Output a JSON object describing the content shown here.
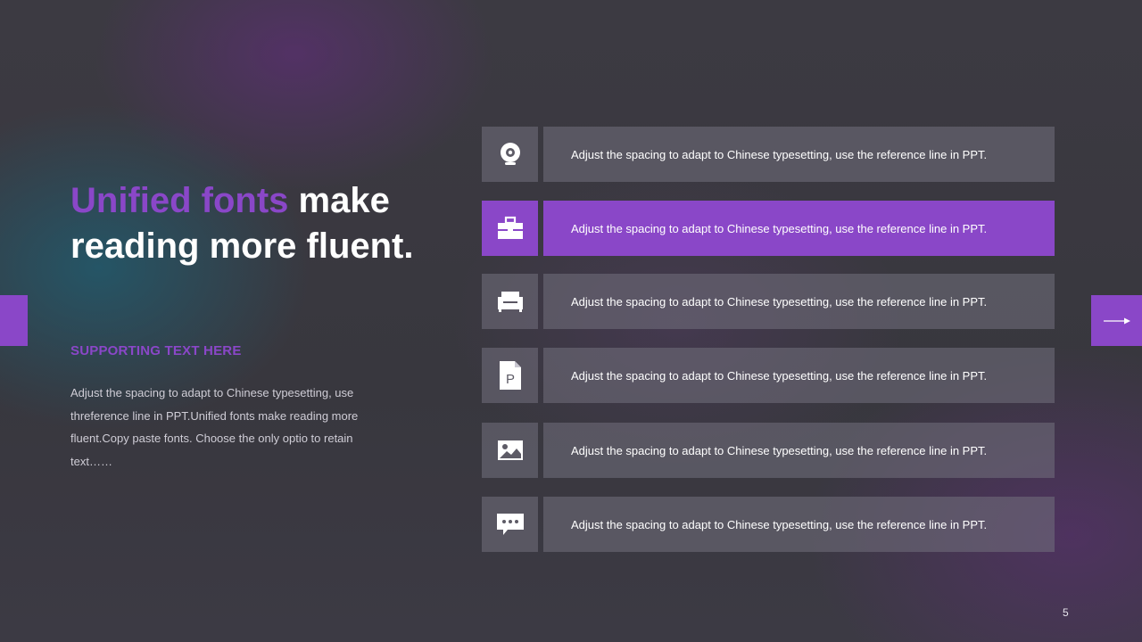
{
  "title": {
    "accent": "Unified fonts",
    "rest": " make reading more fluent."
  },
  "subtitle": "SUPPORTING TEXT HERE",
  "body": "Adjust the spacing to adapt to Chinese typesetting, use threference line in PPT.Unified fonts make reading more fluent.Copy paste fonts. Choose the only optio to retain text……",
  "rows": [
    {
      "icon": "webcam-icon",
      "text": "Adjust the spacing to adapt to Chinese typesetting, use the reference line in PPT.",
      "active": false
    },
    {
      "icon": "toolbox-icon",
      "text": "Adjust the spacing to adapt to Chinese typesetting, use the reference line in PPT.",
      "active": true
    },
    {
      "icon": "sofa-icon",
      "text": "Adjust the spacing to adapt to Chinese typesetting, use the reference line in PPT.",
      "active": false
    },
    {
      "icon": "document-p-icon",
      "text": "Adjust the spacing to adapt to Chinese typesetting, use the reference line in PPT.",
      "active": false
    },
    {
      "icon": "image-icon",
      "text": "Adjust the spacing to adapt to Chinese typesetting, use the reference line in PPT.",
      "active": false
    },
    {
      "icon": "chat-bubble-icon",
      "text": "Adjust the spacing to adapt to Chinese typesetting, use the reference line in PPT.",
      "active": false
    }
  ],
  "icon_glyphs": {
    "document_letter": "P"
  },
  "page_number": "5",
  "colors": {
    "accent": "#8a47c8",
    "background": "#3a3940",
    "row_background": "#5d5b66",
    "text": "#ffffff"
  }
}
